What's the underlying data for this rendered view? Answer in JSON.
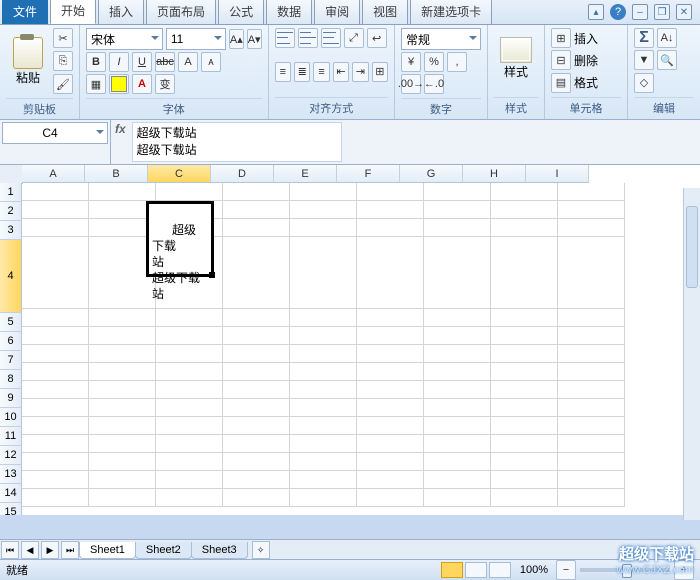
{
  "tabs": {
    "file": "文件",
    "home": "开始",
    "insert": "插入",
    "layout": "页面布局",
    "formulas": "公式",
    "data": "数据",
    "review": "审阅",
    "view": "视图",
    "newtab": "新建选项卡"
  },
  "ribbon": {
    "clipboard": {
      "label": "剪贴板",
      "paste": "粘贴"
    },
    "font": {
      "label": "字体",
      "name": "宋体",
      "size": "11",
      "bold": "B",
      "italic": "I",
      "underline": "U",
      "strike": "abc"
    },
    "align": {
      "label": "对齐方式"
    },
    "number": {
      "label": "数字",
      "format": "常规"
    },
    "styles": {
      "label": "样式",
      "btn": "样式"
    },
    "cells": {
      "label": "单元格",
      "insert": "插入",
      "delete": "删除",
      "format": "格式"
    },
    "editing": {
      "label": "编辑"
    }
  },
  "namebox": "C4",
  "fx": "fx",
  "formula": "超级下载站\n超级下载站",
  "columns": [
    "A",
    "B",
    "C",
    "D",
    "E",
    "F",
    "G",
    "H",
    "I"
  ],
  "rows": [
    "1",
    "2",
    "3",
    "4",
    "5",
    "6",
    "7",
    "8",
    "9",
    "10",
    "11",
    "12",
    "13",
    "14",
    "15"
  ],
  "selectedCell": {
    "col": "C",
    "row": "4",
    "value": "超级下载\n站\n超级下载\n站"
  },
  "sheets": [
    "Sheet1",
    "Sheet2",
    "Sheet3"
  ],
  "status": {
    "ready": "就绪",
    "zoom": "100%"
  },
  "watermark": {
    "title": "超级下载站",
    "url": "www.CJXZ.com"
  }
}
